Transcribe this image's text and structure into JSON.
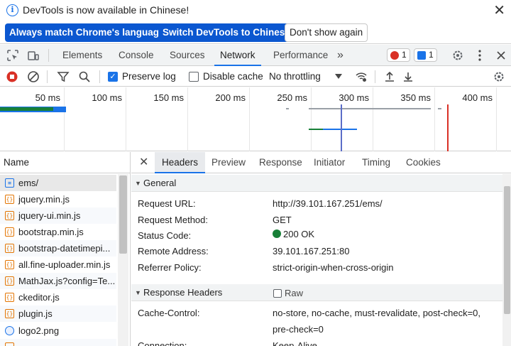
{
  "infobar": {
    "message": "DevTools is now available in Chinese!",
    "btn_match": "Always match Chrome's language",
    "btn_switch": "Switch DevTools to Chinese",
    "btn_dismiss": "Don't show again",
    "close": "✕"
  },
  "tabs": {
    "items": [
      "Elements",
      "Console",
      "Sources",
      "Network",
      "Performance"
    ],
    "more": "»",
    "errors": "1",
    "messages": "1"
  },
  "toolbar": {
    "preserve_log": "Preserve log",
    "disable_cache": "Disable cache",
    "throttling": "No throttling"
  },
  "overview": {
    "ticks": [
      "50 ms",
      "100 ms",
      "150 ms",
      "200 ms",
      "250 ms",
      "300 ms",
      "350 ms",
      "400 ms"
    ]
  },
  "requests": {
    "header": "Name",
    "items": [
      {
        "name": "ems/",
        "type": "doc"
      },
      {
        "name": "jquery.min.js",
        "type": "js"
      },
      {
        "name": "jquery-ui.min.js",
        "type": "js"
      },
      {
        "name": "bootstrap.min.js",
        "type": "js"
      },
      {
        "name": "bootstrap-datetimepi...",
        "type": "js"
      },
      {
        "name": "all.fine-uploader.min.js",
        "type": "js"
      },
      {
        "name": "MathJax.js?config=Te...",
        "type": "js"
      },
      {
        "name": "ckeditor.js",
        "type": "js"
      },
      {
        "name": "plugin.js",
        "type": "js"
      },
      {
        "name": "logo2.png",
        "type": "img"
      }
    ]
  },
  "detail": {
    "close": "✕",
    "tabs": [
      "Headers",
      "Preview",
      "Response",
      "Initiator",
      "Timing",
      "Cookies"
    ],
    "general_title": "General",
    "general": [
      {
        "k": "Request URL:",
        "v": "http://39.101.167.251/ems/"
      },
      {
        "k": "Request Method:",
        "v": "GET"
      },
      {
        "k": "Status Code:",
        "v": "200 OK"
      },
      {
        "k": "Remote Address:",
        "v": "39.101.167.251:80"
      },
      {
        "k": "Referrer Policy:",
        "v": "strict-origin-when-cross-origin"
      }
    ],
    "response_title": "Response Headers",
    "raw_label": "Raw",
    "cache_control_key": "Cache-Control:",
    "cache_control_val1": "no-store, no-cache, must-revalidate, post-check=0,",
    "cache_control_val2": "pre-check=0",
    "connection_key": "Connection:",
    "connection_val": "Keep-Alive"
  },
  "colors": {
    "accent": "#1a73e8",
    "button_blue": "#0b57d0",
    "error_red": "#d93025",
    "status_green": "#188038"
  }
}
